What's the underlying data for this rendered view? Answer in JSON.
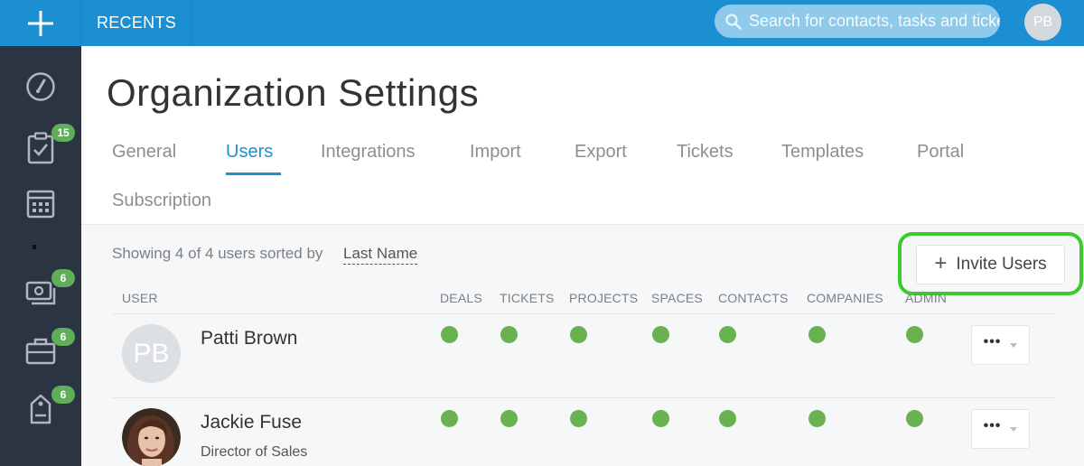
{
  "topbar": {
    "recents_label": "RECENTS",
    "search_placeholder": "Search for contacts, tasks and tickets",
    "avatar_initials": "PB"
  },
  "sidebar": {
    "items": [
      {
        "icon": "dashboard-icon",
        "badge": null
      },
      {
        "icon": "tasks-clipboard-icon",
        "badge": "15"
      },
      {
        "icon": "calendar-icon",
        "badge": null
      },
      {
        "icon": "deals-money-icon",
        "badge": "6"
      },
      {
        "icon": "briefcase-icon",
        "badge": "6"
      },
      {
        "icon": "tickets-tag-icon",
        "badge": "6"
      }
    ]
  },
  "page": {
    "title": "Organization Settings",
    "tabs": [
      "General",
      "Users",
      "Integrations",
      "Import",
      "Export",
      "Tickets",
      "Templates",
      "Portal",
      "Subscription"
    ],
    "active_tab": "Users"
  },
  "users_panel": {
    "showing_text": "Showing 4 of 4 users sorted by",
    "sort_field": "Last Name",
    "invite_label": "Invite Users",
    "columns": [
      "USER",
      "DEALS",
      "TICKETS",
      "PROJECTS",
      "SPACES",
      "CONTACTS",
      "COMPANIES",
      "ADMIN"
    ],
    "rows": [
      {
        "name": "Patti Brown",
        "title": "",
        "avatar_initials": "PB"
      },
      {
        "name": "Jackie Fuse",
        "title": "Director of Sales",
        "avatar_initials": ""
      }
    ],
    "more_label": "•••"
  },
  "colors": {
    "brand_blue": "#1b8fd2",
    "sidebar": "#2b3440",
    "badge_green": "#5fae5a",
    "permission_dot": "#6ab150",
    "highlight_ring": "#3ccb2c"
  }
}
